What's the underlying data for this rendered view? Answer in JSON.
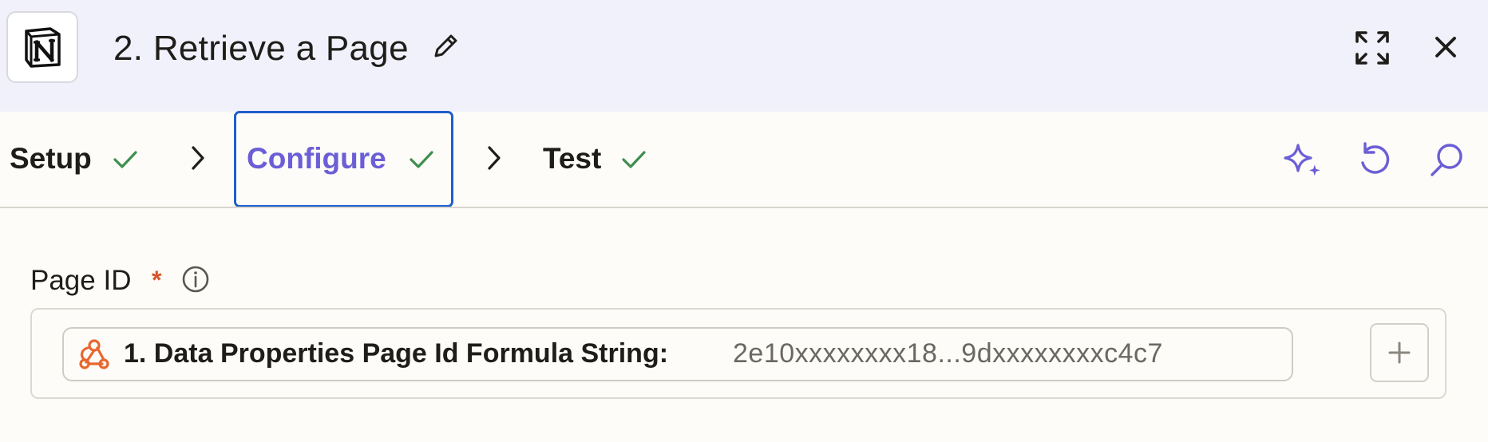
{
  "header": {
    "app_icon": "notion-logo-icon",
    "step_title": "2. Retrieve a Page"
  },
  "tabs": [
    {
      "label": "Setup",
      "status": "complete"
    },
    {
      "label": "Configure",
      "status": "complete",
      "active": true
    },
    {
      "label": "Test",
      "status": "complete"
    }
  ],
  "toolbar_icons": [
    "sparkle-icon",
    "undo-icon",
    "search-icon"
  ],
  "field": {
    "label": "Page ID",
    "required_mark": "*",
    "pill": {
      "icon": "webhook-icon",
      "label": "1. Data Properties Page Id Formula String:",
      "value": "2e10xxxxxxxx18...9dxxxxxxxxc4c7"
    }
  },
  "colors": {
    "header_bg": "#f1f1fb",
    "active_tab": "#6b5ed6",
    "check": "#3e8e4f",
    "focus_border": "#1e5fcc",
    "required": "#d9542b",
    "webhook_icon": "#e8672e"
  }
}
